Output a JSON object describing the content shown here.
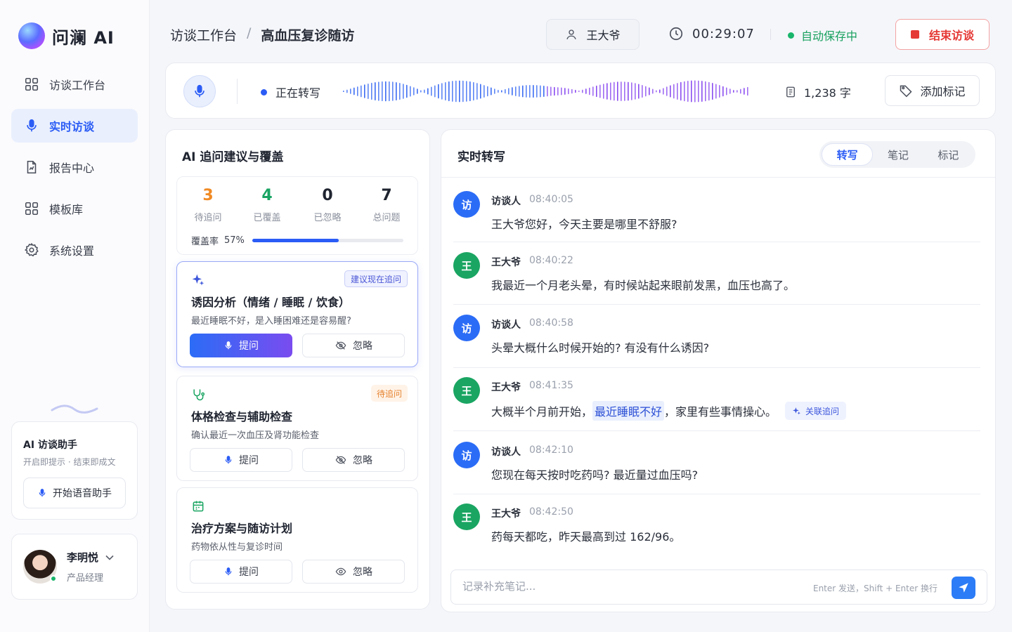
{
  "app": {
    "logo_text": "问澜 AI"
  },
  "sidebar": {
    "items": [
      {
        "label": "访谈工作台",
        "icon": "grid-icon"
      },
      {
        "label": "实时访谈",
        "icon": "mic-icon",
        "active": true
      },
      {
        "label": "报告中心",
        "icon": "report-icon"
      },
      {
        "label": "模板库",
        "icon": "grid-icon"
      },
      {
        "label": "系统设置",
        "icon": "gear-icon"
      }
    ],
    "assistant": {
      "title": "AI 访谈助手",
      "subtitle": "开启即提示 · 结束即成文",
      "button": "开始语音助手"
    },
    "user": {
      "name": "李明悦",
      "role": "产品经理"
    }
  },
  "header": {
    "breadcrumb_root": "访谈工作台",
    "breadcrumb_sep": "/",
    "breadcrumb_current": "高血压复诊随访",
    "patient": "王大爷",
    "timer": "00:29:07",
    "autosave": "自动保存中",
    "end_button": "结束访谈"
  },
  "recording": {
    "status": "正在转写",
    "word_count": "1,238 字",
    "mark_button": "添加标记"
  },
  "ai_panel": {
    "title": "AI 追问建议与覆盖",
    "stats": [
      {
        "value": "3",
        "label": "待追问",
        "color": "#f08a24"
      },
      {
        "value": "4",
        "label": "已覆盖",
        "color": "#19a463"
      },
      {
        "value": "0",
        "label": "已忽略",
        "color": "#1f2430"
      },
      {
        "value": "7",
        "label": "总问题",
        "color": "#1f2430"
      }
    ],
    "coverage_label": "覆盖率",
    "coverage_value": "57%",
    "coverage_fraction": 0.57,
    "cards": [
      {
        "icon": "sparkle-icon",
        "badge": "建议现在追问",
        "badge_type": "suggest",
        "title": "诱因分析（情绪 / 睡眠 / 饮食）",
        "desc": "最近睡眠不好，是入睡困难还是容易醒?",
        "ask": "提问",
        "ignore": "忽略",
        "active": true
      },
      {
        "icon": "stethoscope-icon",
        "badge": "待追问",
        "badge_type": "pending",
        "title": "体格检查与辅助检查",
        "desc": "确认最近一次血压及肾功能检查",
        "ask": "提问",
        "ignore": "忽略"
      },
      {
        "icon": "calendar-icon",
        "badge": "",
        "title": "治疗方案与随访计划",
        "desc": "药物依从性与复诊时间",
        "ask": "提问",
        "ignore": "忽略"
      }
    ]
  },
  "transcript": {
    "title": "实时转写",
    "tabs": [
      "转写",
      "笔记",
      "标记"
    ],
    "messages": [
      {
        "avatar": "访",
        "speaker": "访谈人",
        "time": "08:40:05",
        "text": "王大爷您好，今天主要是哪里不舒服?",
        "role": "interviewer"
      },
      {
        "avatar": "王",
        "speaker": "王大爷",
        "time": "08:40:22",
        "text": "我最近一个月老头晕，有时候站起来眼前发黑，血压也高了。",
        "role": "patient"
      },
      {
        "avatar": "访",
        "speaker": "访谈人",
        "time": "08:40:58",
        "text": "头晕大概什么时候开始的? 有没有什么诱因?",
        "role": "interviewer"
      },
      {
        "avatar": "王",
        "speaker": "王大爷",
        "time": "08:41:35",
        "text_pre": "大概半个月前开始，",
        "highlight": "最近睡眠不好",
        "text_post": "，家里有些事情操心。",
        "tag": "关联追问",
        "role": "patient"
      },
      {
        "avatar": "访",
        "speaker": "访谈人",
        "time": "08:42:10",
        "text": "您现在每天按时吃药吗? 最近量过血压吗?",
        "role": "interviewer"
      },
      {
        "avatar": "王",
        "speaker": "王大爷",
        "time": "08:42:50",
        "text": "药每天都吃，昨天最高到过 162/96。",
        "role": "patient"
      }
    ],
    "input_placeholder": "记录补充笔记...",
    "input_hint": "Enter 发送，Shift + Enter 换行"
  },
  "colors": {
    "accent": "#2b5cf5",
    "success": "#19b56b",
    "danger": "#e53935",
    "warning": "#f08a24"
  }
}
